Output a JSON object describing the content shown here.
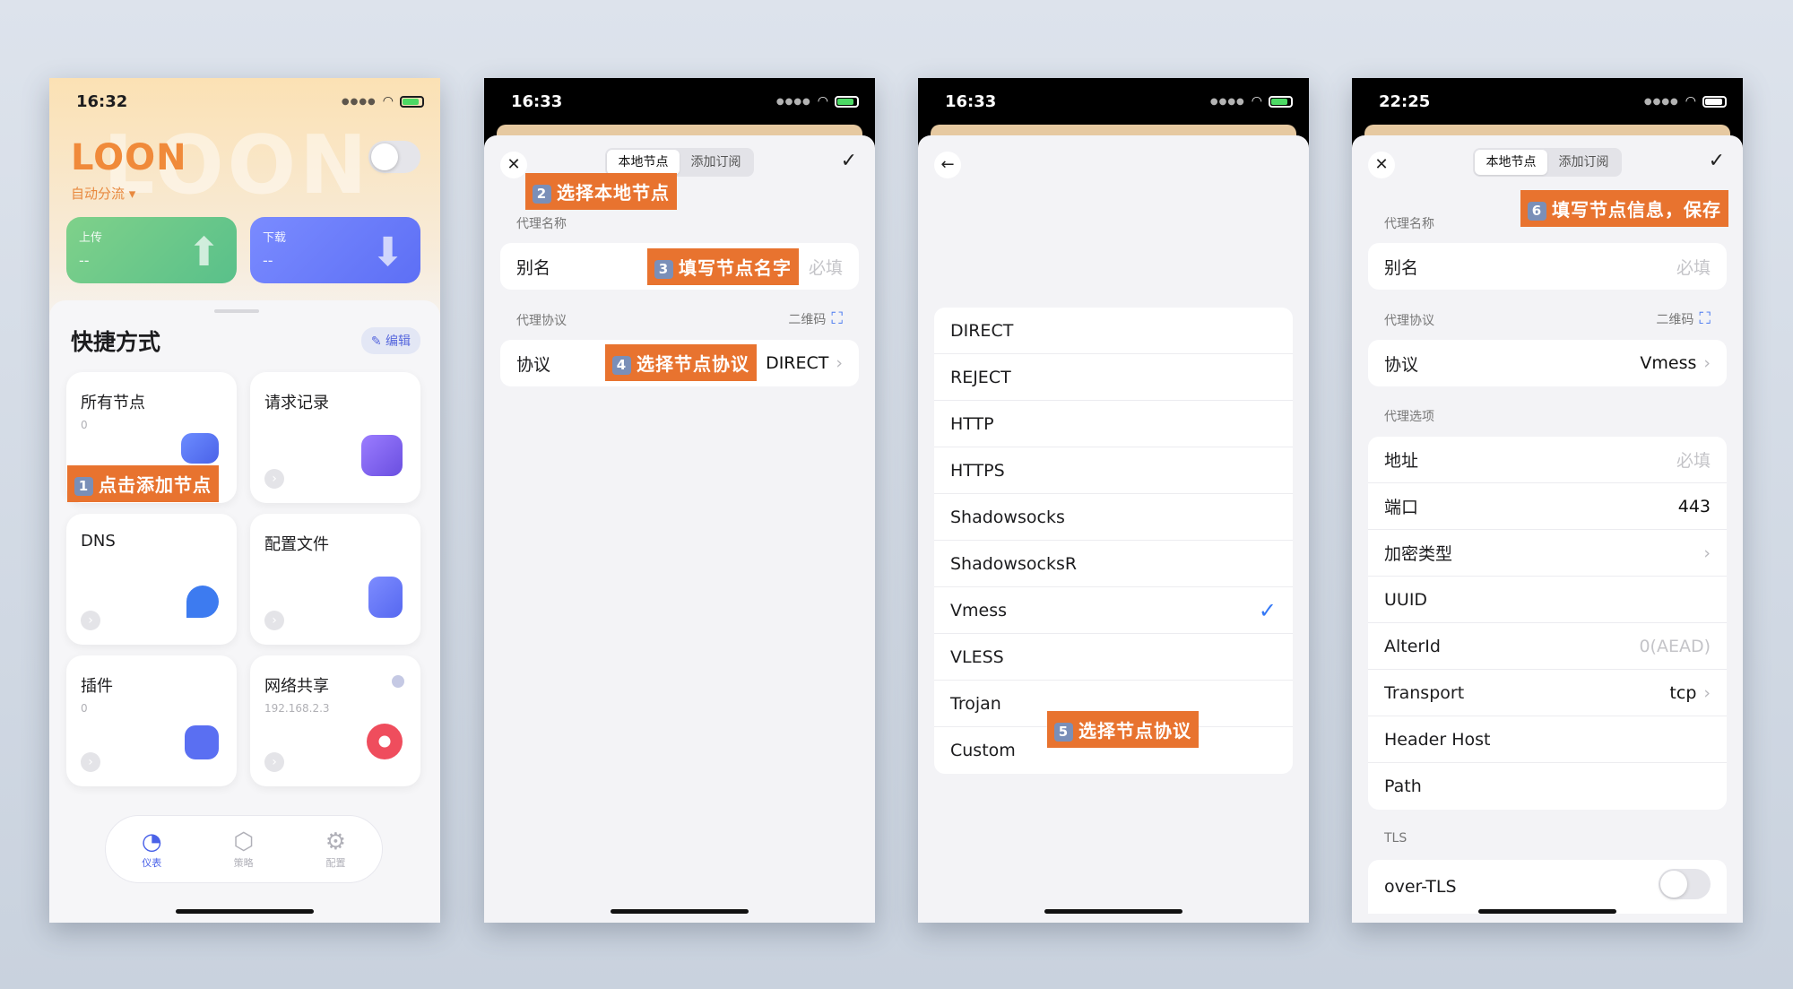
{
  "phone1": {
    "time": "16:32",
    "brand": "LOON",
    "mode": "自动分流 ▾",
    "upload": {
      "label": "上传",
      "value": "--"
    },
    "download": {
      "label": "下载",
      "value": "--"
    },
    "section_title": "快捷方式",
    "edit": "编辑",
    "tiles": {
      "all_nodes": {
        "label": "所有节点",
        "sub": "0"
      },
      "requests": {
        "label": "请求记录"
      },
      "dns": {
        "label": "DNS"
      },
      "profile": {
        "label": "配置文件"
      },
      "plugins": {
        "label": "插件",
        "sub": "0"
      },
      "sharing": {
        "label": "网络共享",
        "sub": "192.168.2.3"
      }
    },
    "tabs": {
      "dashboard": "仪表",
      "policy": "策略",
      "config": "配置"
    },
    "annotation": {
      "num": "1",
      "text": "点击添加节点"
    }
  },
  "phone2": {
    "time": "16:33",
    "seg_local": "本地节点",
    "seg_sub": "添加订阅",
    "name_section": "代理名称",
    "alias_label": "别名",
    "alias_placeholder": "必填",
    "proto_section": "代理协议",
    "qr_label": "二维码",
    "proto_label": "协议",
    "proto_value": "DIRECT",
    "ann2": {
      "num": "2",
      "text": "选择本地节点"
    },
    "ann3": {
      "num": "3",
      "text": "填写节点名字"
    },
    "ann4": {
      "num": "4",
      "text": "选择节点协议"
    }
  },
  "phone3": {
    "time": "16:33",
    "protocols": [
      "DIRECT",
      "REJECT",
      "HTTP",
      "HTTPS",
      "Shadowsocks",
      "ShadowsocksR",
      "Vmess",
      "VLESS",
      "Trojan",
      "Custom"
    ],
    "selected": "Vmess",
    "ann5": {
      "num": "5",
      "text": "选择节点协议"
    }
  },
  "phone4": {
    "time": "22:25",
    "seg_local": "本地节点",
    "seg_sub": "添加订阅",
    "name_section": "代理名称",
    "alias_label": "别名",
    "alias_placeholder": "必填",
    "proto_section": "代理协议",
    "qr_label": "二维码",
    "proto_label": "协议",
    "proto_value": "Vmess",
    "options_section": "代理选项",
    "fields": {
      "address": {
        "label": "地址",
        "placeholder": "必填"
      },
      "port": {
        "label": "端口",
        "value": "443"
      },
      "cipher": {
        "label": "加密类型"
      },
      "uuid": {
        "label": "UUID"
      },
      "alterid": {
        "label": "AlterId",
        "placeholder": "0(AEAD)"
      },
      "transport": {
        "label": "Transport",
        "value": "tcp"
      },
      "header_host": {
        "label": "Header Host"
      },
      "path": {
        "label": "Path"
      }
    },
    "tls_section": "TLS",
    "over_tls": "over-TLS",
    "ann6": {
      "num": "6",
      "text": "填写节点信息，保存"
    }
  },
  "colors": {
    "accent": "#e8732f",
    "loon_orange": "#f08a3a",
    "blue": "#3478f6"
  }
}
